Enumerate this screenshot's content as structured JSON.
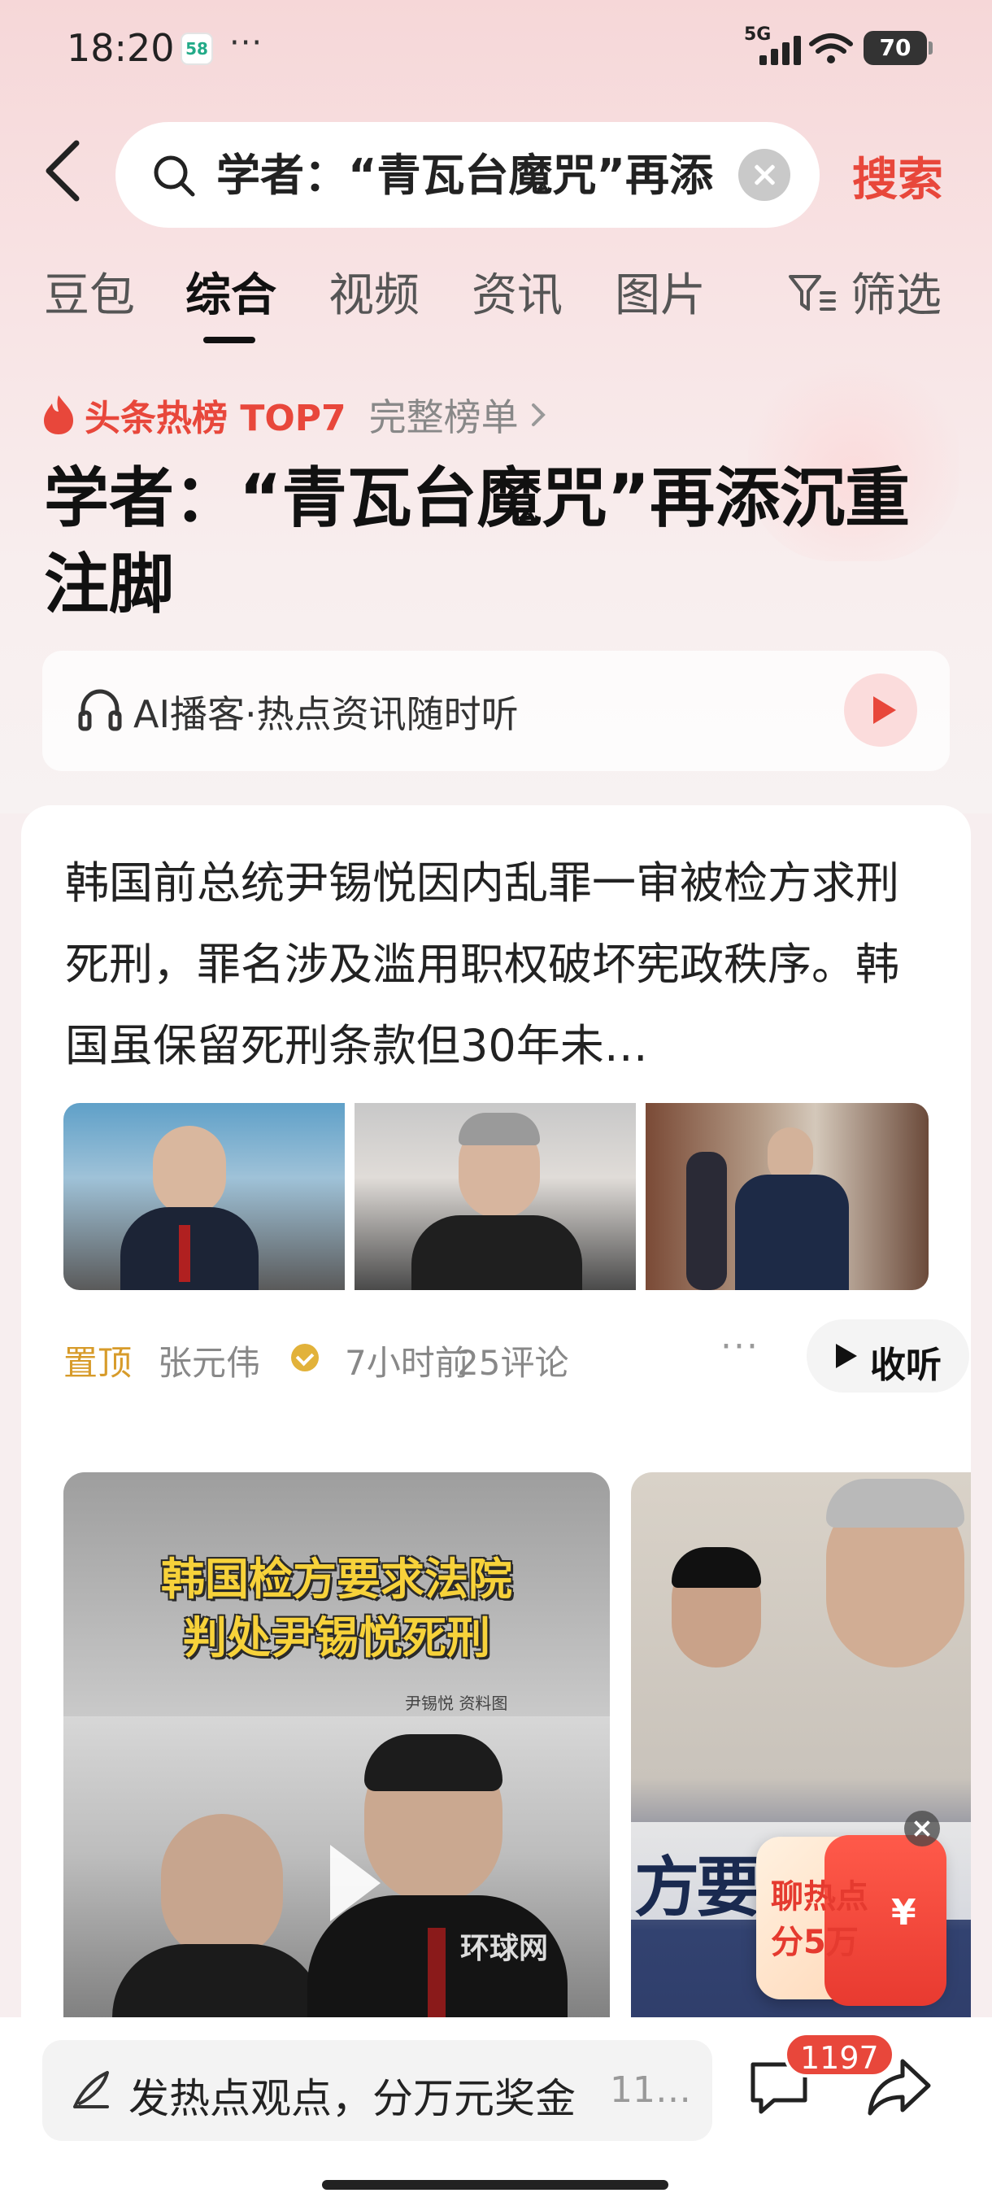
{
  "status_bar": {
    "time": "18:20",
    "app_badge": "58",
    "more": "···",
    "network": "5G",
    "battery": "70"
  },
  "search": {
    "query": "学者：“青瓦台魔咒”再添",
    "button": "搜索"
  },
  "tabs": [
    {
      "label": "豆包"
    },
    {
      "label": "综合"
    },
    {
      "label": "视频"
    },
    {
      "label": "资讯"
    },
    {
      "label": "图片"
    },
    {
      "label": "筛选"
    }
  ],
  "hot": {
    "title": "头条热榜 TOP7",
    "full_list": "完整榜单",
    "headline": "学者：“青瓦台魔咒”再添沉重注脚"
  },
  "podcast": {
    "label": "AI播客·热点资讯随时听"
  },
  "article": {
    "text": "韩国前总统尹锡悦因内乱罪一审被检方求刑死刑，罪名涉及滥用职权破坏宪政秩序。韩国虽保留死刑条款但30年未…",
    "pinned": "置顶",
    "author": "张元伟",
    "time": "7小时前",
    "comments": "25评论",
    "more": "···",
    "listen": "收听"
  },
  "videos": [
    {
      "caption_line1": "韩国检方要求法院",
      "caption_line2": "判处尹锡悦死刑",
      "small_label": "尹锡悦 资料图",
      "watermark": "环球网"
    },
    {
      "overlay_text": "方要"
    }
  ],
  "promo": {
    "line1": "聊热点",
    "line2": "分5万",
    "currency": "¥"
  },
  "bottom": {
    "comment_placeholder": "发热点观点，分万元奖金",
    "comment_more": "11…",
    "badge": "1197"
  },
  "colors": {
    "accent": "#e8473b",
    "pin": "#d79b2a",
    "caption": "#f7d23a"
  },
  "icons": [
    "back-icon",
    "search-icon",
    "clear-icon",
    "filter-icon",
    "fire-icon",
    "chevron-right-icon",
    "headphone-icon",
    "play-icon",
    "verify-icon",
    "pen-icon",
    "message-icon",
    "share-icon"
  ]
}
